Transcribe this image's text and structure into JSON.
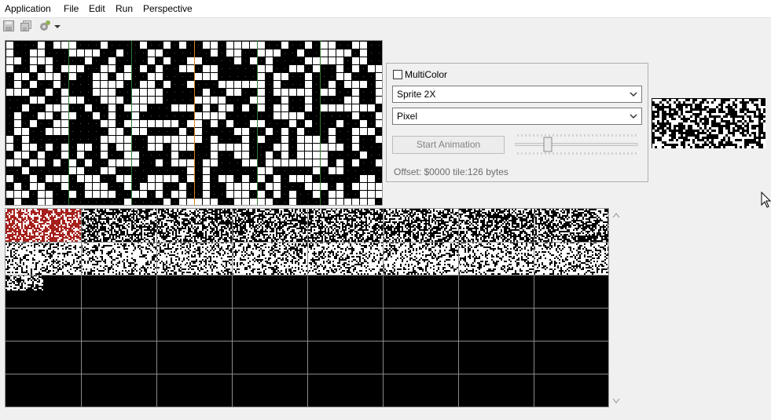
{
  "menu": {
    "items": [
      "Application",
      "File",
      "Edit",
      "Run",
      "Perspective"
    ]
  },
  "toolbar": {
    "icons": [
      "save-icon",
      "save-all-icon",
      "run-config-icon",
      "dropdown-arrow-icon"
    ]
  },
  "panel": {
    "multicolor_label": "MultiColor",
    "multicolor_checked": false,
    "mode_select_value": "Sprite 2X",
    "paint_select_value": "Pixel",
    "start_animation_label": "Start Animation",
    "animation_speed": 0.25,
    "offset_text": "Offset: $0000 tile:126 bytes"
  },
  "colors": {
    "background": "#f0f0f0",
    "canvas": "#000000",
    "pixel_on": "#ffffff",
    "pixel_grid": "#333333",
    "selected_tile": "#a6201c",
    "separator_green": "#2f7a2f",
    "separator_orange": "#d7831b"
  }
}
